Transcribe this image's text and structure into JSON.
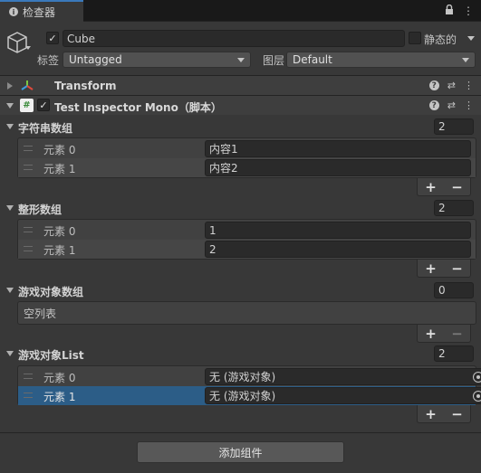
{
  "tab": {
    "title": "检查器",
    "icons": [
      "lock-icon",
      "menu-icon"
    ]
  },
  "object": {
    "active": true,
    "name": "Cube",
    "static_label": "静态的",
    "tag_label": "标签",
    "tag_value": "Untagged",
    "layer_label": "图层",
    "layer_value": "Default"
  },
  "components": [
    {
      "title": "Transform",
      "expanded": false,
      "has_checkbox": false
    },
    {
      "title": "Test Inspector Mono（脚本）",
      "expanded": true,
      "has_checkbox": true,
      "enabled": true
    }
  ],
  "lists": [
    {
      "title": "字符串数组",
      "size": "2",
      "items": [
        {
          "label": "元素 0",
          "value": "内容1"
        },
        {
          "label": "元素 1",
          "value": "内容2"
        }
      ]
    },
    {
      "title": "整形数组",
      "size": "2",
      "items": [
        {
          "label": "元素 0",
          "value": "1"
        },
        {
          "label": "元素 1",
          "value": "2"
        }
      ]
    },
    {
      "title": "游戏对象数组",
      "size": "0",
      "empty_text": "空列表",
      "items": []
    },
    {
      "title": "游戏对象List",
      "size": "2",
      "items": [
        {
          "label": "元素 0",
          "value": "无 (游戏对象)"
        },
        {
          "label": "元素 1",
          "value": "无 (游戏对象)",
          "selected": true
        }
      ]
    }
  ],
  "footer_buttons": {
    "plus": "+",
    "minus": "−"
  },
  "add_component_label": "添加组件",
  "colors": {
    "accent": "#3a79bb",
    "selection": "#2c5d87",
    "panel": "#383838"
  }
}
